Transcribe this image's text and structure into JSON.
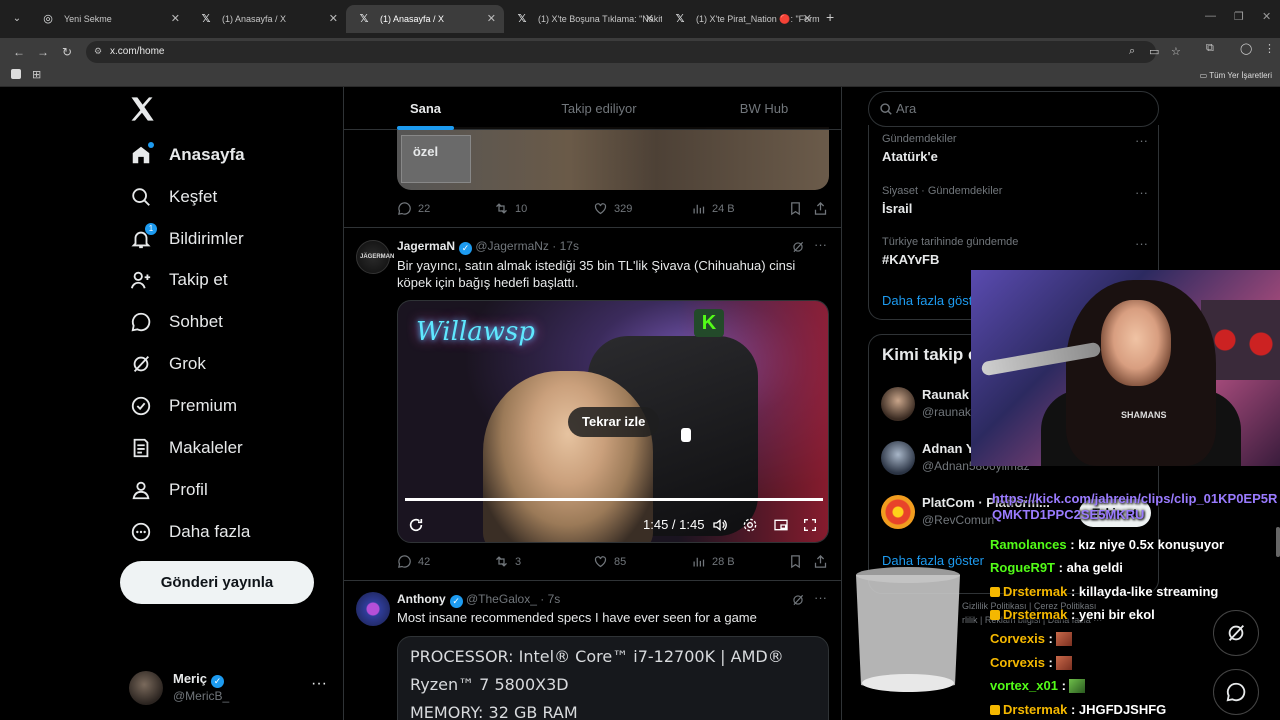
{
  "browser": {
    "tabs": [
      {
        "label": "Yeni Sekme",
        "favicon": "chrome-icon"
      },
      {
        "label": "(1) Anasayfa / X",
        "favicon": "x-icon"
      },
      {
        "label": "(1) Anasayfa / X",
        "favicon": "x-icon",
        "active": true
      },
      {
        "label": "(1) X'te Boşuna Tıklama: \"Nakit",
        "favicon": "x-icon"
      },
      {
        "label": "(1) X'te Pirat_Nation 🔴: \"Form",
        "favicon": "x-icon"
      }
    ],
    "url": "x.com/home",
    "bookmarks_all": "Tüm Yer İşaretleri"
  },
  "nav": {
    "items": [
      {
        "label": "Anasayfa",
        "icon": "home-icon",
        "active": true
      },
      {
        "label": "Keşfet",
        "icon": "search-icon"
      },
      {
        "label": "Bildirimler",
        "icon": "bell-icon",
        "badge": "1"
      },
      {
        "label": "Takip et",
        "icon": "follow-icon"
      },
      {
        "label": "Sohbet",
        "icon": "chat-icon"
      },
      {
        "label": "Grok",
        "icon": "grok-icon"
      },
      {
        "label": "Premium",
        "icon": "premium-icon"
      },
      {
        "label": "Makaleler",
        "icon": "articles-icon"
      },
      {
        "label": "Profil",
        "icon": "profile-icon"
      },
      {
        "label": "Daha fazla",
        "icon": "more-icon"
      }
    ],
    "post_button": "Gönderi yayınla",
    "account": {
      "name": "Meriç",
      "handle": "@MericB_"
    }
  },
  "timeline": {
    "tabs": [
      "Sana özel",
      "Takip ediliyor",
      "BW Hub"
    ],
    "prev_actions": {
      "replies": "22",
      "reposts": "10",
      "likes": "329",
      "views": "24 B"
    },
    "tweet2": {
      "name": "JagermaN",
      "handle": "@JagermaNz",
      "time": "· 17s",
      "text": "Bir yayıncı, satın almak istediği 35 bin TL'lik Şivava (Chihuahua) cinsi köpek için bağış hedefi başlattı.",
      "video": {
        "neon": "Willawsp",
        "replay": "Tekrar izle",
        "time": "1:45 / 1:45",
        "progress": 1.0
      },
      "actions": {
        "replies": "42",
        "reposts": "3",
        "likes": "85",
        "views": "28 B"
      }
    },
    "tweet3": {
      "name": "Anthony",
      "handle": "@TheGalox_",
      "time": "· 7s",
      "text": "Most insane recommended specs I have ever seen for a game",
      "card_lines": [
        "PROCESSOR:  Intel® Core™ i7-12700K | AMD®",
        "Ryzen™ 7 5800X3D",
        "MEMORY:  32 GB RAM"
      ]
    }
  },
  "sidebar": {
    "search_placeholder": "Ara",
    "trends": [
      {
        "context": "Gündemdekiler",
        "title": "Atatürk'e"
      },
      {
        "context": "Siyaset · Gündemdekiler",
        "title": "İsrail"
      },
      {
        "context": "Türkiye tarihinde gündemde",
        "title": "#KAYvFB"
      }
    ],
    "trends_more": "Daha fazla göster",
    "wtf_title": "Kimi takip e",
    "wtf": [
      {
        "name": "Raunak",
        "handle": "@raunak"
      },
      {
        "name": "Adnan Y",
        "handle": "@Adnan5806yilmaz"
      },
      {
        "name": "PlatCom · Platform...",
        "handle": "@RevComun",
        "follow": "Takip et"
      }
    ],
    "wtf_more": "Daha fazla göster",
    "footer": [
      "Gizlilik Politikası",
      "Çerez Politikası",
      "Reklam bilgisi",
      "Daha fazla ···",
      "rlilik"
    ]
  },
  "overlay": {
    "cam_logo": "SHAMANS",
    "chat_link": "https://kick.com/jahrein/clips/clip_01KP0EP5R QMKTD1PPC2SE5MKRU",
    "chat": [
      {
        "user": "Ramolances",
        "color": "#53fc18",
        "msg": "kız niye 0.5x konuşuyor"
      },
      {
        "user": "RogueR9T",
        "color": "#53fc18",
        "msg": "aha geldi"
      },
      {
        "user": "Drstermak",
        "color": "#f5b800",
        "msg": "killayda-like streaming",
        "badge": true
      },
      {
        "user": "Drstermak",
        "color": "#f5b800",
        "msg": "yeni bir ekol",
        "badge": true
      },
      {
        "user": "Corvexis",
        "color": "#f5b800",
        "msg": "",
        "emote": true
      },
      {
        "user": "Corvexis",
        "color": "#f5b800",
        "msg": "",
        "emote": true
      },
      {
        "user": "vortex_x01",
        "color": "#53fc18",
        "msg": "",
        "emote": true
      },
      {
        "user": "Drstermak",
        "color": "#f5b800",
        "msg": "JHGFDJSHFG",
        "badge": true
      }
    ]
  }
}
